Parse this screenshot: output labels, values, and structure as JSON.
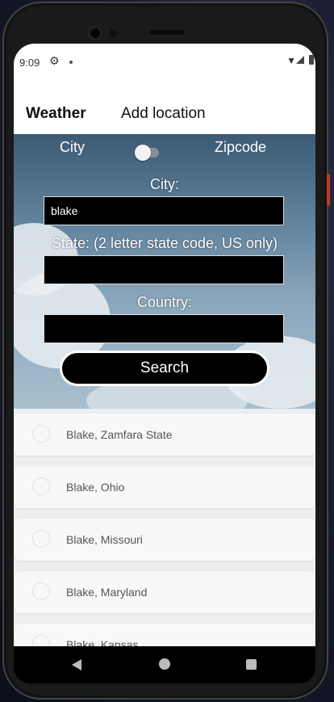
{
  "status_bar": {
    "time": "9:09",
    "icons": [
      "gear-icon",
      "dot-icon",
      "wifi-icon",
      "signal-icon",
      "battery-icon"
    ]
  },
  "tabs": [
    {
      "label": "Weather",
      "active": true
    },
    {
      "label": "Add location",
      "active": false
    }
  ],
  "search_form": {
    "mode_toggle": {
      "left_label": "City",
      "right_label": "Zipcode",
      "checked": false
    },
    "city": {
      "label": "City:",
      "value": "blake"
    },
    "state": {
      "label": "State: (2 letter state code, US only)",
      "value": ""
    },
    "country": {
      "label": "Country:",
      "value": ""
    },
    "search_button": "Search"
  },
  "results": [
    {
      "label": "Blake, Zamfara State"
    },
    {
      "label": "Blake, Ohio"
    },
    {
      "label": "Blake, Missouri"
    },
    {
      "label": "Blake, Maryland"
    },
    {
      "label": "Blake, Kansas"
    }
  ],
  "nav_bar": {
    "icons": [
      "back-icon",
      "home-icon",
      "recents-icon"
    ]
  },
  "colors": {
    "hero_sky": "#5f809b",
    "field_bg": "#000000",
    "button_bg": "#000000",
    "tab_active_text": "#111111"
  }
}
